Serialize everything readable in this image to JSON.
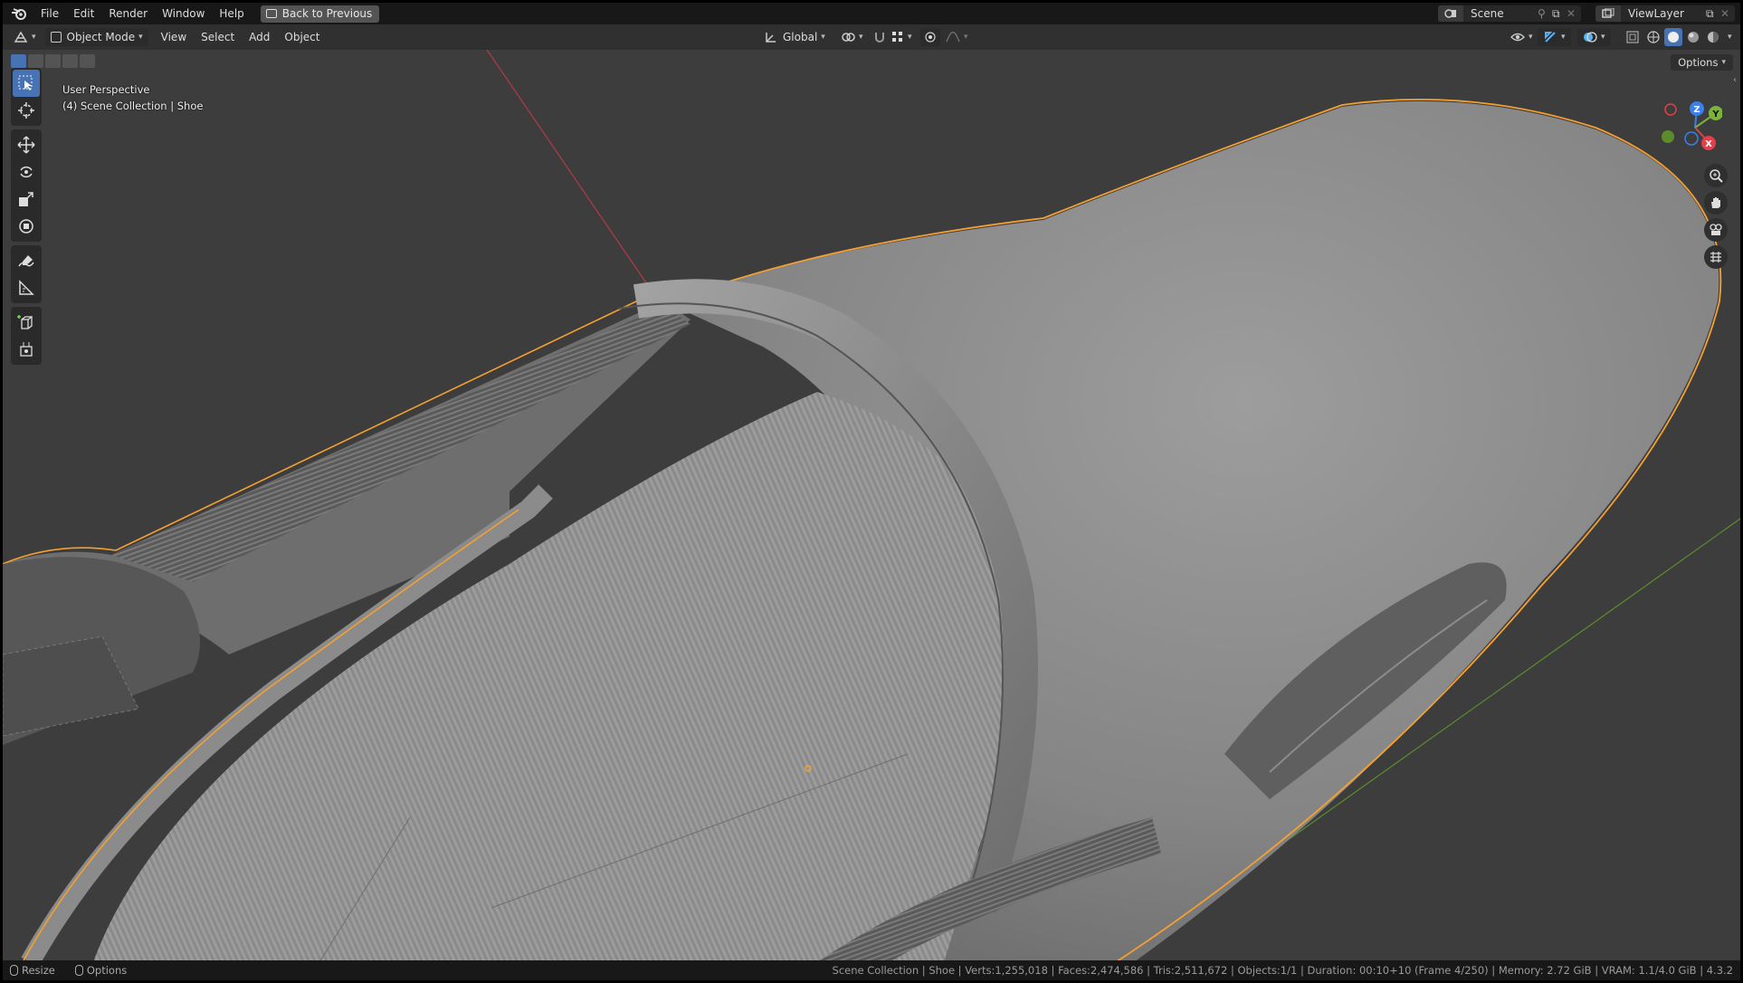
{
  "menubar": {
    "items": [
      "File",
      "Edit",
      "Render",
      "Window",
      "Help"
    ],
    "back_button": "Back to Previous",
    "scene_name": "Scene",
    "view_layer": "ViewLayer"
  },
  "header": {
    "mode": "Object Mode",
    "menus": [
      "View",
      "Select",
      "Add",
      "Object"
    ],
    "orientation": "Global",
    "options_label": "Options"
  },
  "viewport": {
    "perspective_label": "User Perspective",
    "collection_label": "(4) Scene Collection | Shoe",
    "axes": {
      "x": "X",
      "y": "Y",
      "z": "Z"
    }
  },
  "toolbar": {
    "tools": [
      "select-box",
      "cursor",
      "move",
      "rotate",
      "scale",
      "transform",
      "annotate",
      "measure",
      "add-cube",
      "add-object"
    ]
  },
  "statusbar": {
    "left_resize": "Resize",
    "left_options": "Options",
    "info": "Scene Collection | Shoe | Verts:1,255,018 | Faces:2,474,586 | Tris:2,511,672 | Objects:1/1 | Duration: 00:10+10 (Frame 4/250) | Memory: 2.72 GiB | VRAM: 1.1/4.0 GiB | 4.3.2"
  },
  "colors": {
    "accent": "#4772b3",
    "selection_outline": "#f5a030",
    "x_axis": "#e0404a",
    "y_axis": "#7bb33a",
    "z_axis": "#3a80e8"
  }
}
